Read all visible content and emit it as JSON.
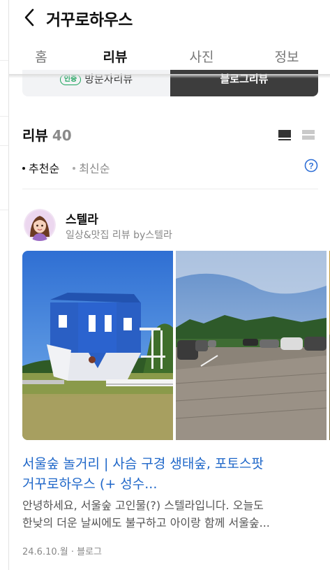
{
  "header": {
    "title": "거꾸로하우스"
  },
  "tabs": [
    {
      "label": "홈"
    },
    {
      "label": "리뷰"
    },
    {
      "label": "사진"
    },
    {
      "label": "정보"
    }
  ],
  "toggle": {
    "badge": "인증",
    "visitor_label": "방문자리뷰",
    "blog_label": "블로그리뷰"
  },
  "review": {
    "heading": "리뷰",
    "count": "40"
  },
  "sort": {
    "recommended": "추천순",
    "latest": "최신순"
  },
  "post": {
    "author_name": "스텔라",
    "author_sub": "일상&맛집 리뷰 by스텔라",
    "title_line1": "서울숲 놀거리 | 사슴 구경 생태숲, 포토스팟",
    "title_line2": "거꾸로하우스 (+ 성수...",
    "excerpt_line1": "안녕하세요, 서울숲 고인물(?) 스텔라입니다. 오늘도",
    "excerpt_line2": "한낮의 더운 날씨에도 불구하고 아이랑 함께 서울숲...",
    "date": "24.6.10.월",
    "source": "블로그"
  },
  "colors": {
    "link": "#1f67c9",
    "badge": "#1aa35b",
    "help": "#2f6fd6"
  },
  "icons": [
    "back-arrow-icon",
    "list-view-icon",
    "card-view-icon",
    "help-icon"
  ]
}
